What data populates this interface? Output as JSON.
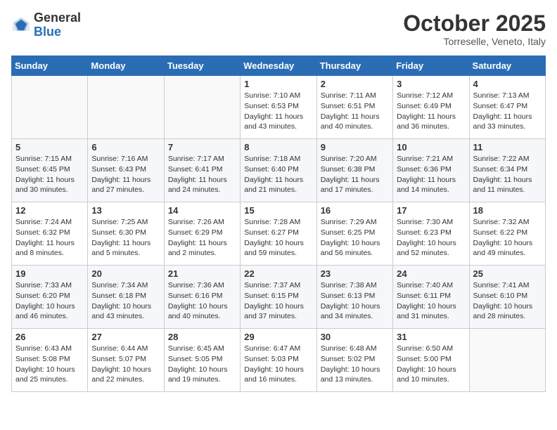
{
  "header": {
    "logo_general": "General",
    "logo_blue": "Blue",
    "month": "October 2025",
    "location": "Torreselle, Veneto, Italy"
  },
  "days_of_week": [
    "Sunday",
    "Monday",
    "Tuesday",
    "Wednesday",
    "Thursday",
    "Friday",
    "Saturday"
  ],
  "weeks": [
    [
      {
        "day": "",
        "info": ""
      },
      {
        "day": "",
        "info": ""
      },
      {
        "day": "",
        "info": ""
      },
      {
        "day": "1",
        "info": "Sunrise: 7:10 AM\nSunset: 6:53 PM\nDaylight: 11 hours and 43 minutes."
      },
      {
        "day": "2",
        "info": "Sunrise: 7:11 AM\nSunset: 6:51 PM\nDaylight: 11 hours and 40 minutes."
      },
      {
        "day": "3",
        "info": "Sunrise: 7:12 AM\nSunset: 6:49 PM\nDaylight: 11 hours and 36 minutes."
      },
      {
        "day": "4",
        "info": "Sunrise: 7:13 AM\nSunset: 6:47 PM\nDaylight: 11 hours and 33 minutes."
      }
    ],
    [
      {
        "day": "5",
        "info": "Sunrise: 7:15 AM\nSunset: 6:45 PM\nDaylight: 11 hours and 30 minutes."
      },
      {
        "day": "6",
        "info": "Sunrise: 7:16 AM\nSunset: 6:43 PM\nDaylight: 11 hours and 27 minutes."
      },
      {
        "day": "7",
        "info": "Sunrise: 7:17 AM\nSunset: 6:41 PM\nDaylight: 11 hours and 24 minutes."
      },
      {
        "day": "8",
        "info": "Sunrise: 7:18 AM\nSunset: 6:40 PM\nDaylight: 11 hours and 21 minutes."
      },
      {
        "day": "9",
        "info": "Sunrise: 7:20 AM\nSunset: 6:38 PM\nDaylight: 11 hours and 17 minutes."
      },
      {
        "day": "10",
        "info": "Sunrise: 7:21 AM\nSunset: 6:36 PM\nDaylight: 11 hours and 14 minutes."
      },
      {
        "day": "11",
        "info": "Sunrise: 7:22 AM\nSunset: 6:34 PM\nDaylight: 11 hours and 11 minutes."
      }
    ],
    [
      {
        "day": "12",
        "info": "Sunrise: 7:24 AM\nSunset: 6:32 PM\nDaylight: 11 hours and 8 minutes."
      },
      {
        "day": "13",
        "info": "Sunrise: 7:25 AM\nSunset: 6:30 PM\nDaylight: 11 hours and 5 minutes."
      },
      {
        "day": "14",
        "info": "Sunrise: 7:26 AM\nSunset: 6:29 PM\nDaylight: 11 hours and 2 minutes."
      },
      {
        "day": "15",
        "info": "Sunrise: 7:28 AM\nSunset: 6:27 PM\nDaylight: 10 hours and 59 minutes."
      },
      {
        "day": "16",
        "info": "Sunrise: 7:29 AM\nSunset: 6:25 PM\nDaylight: 10 hours and 56 minutes."
      },
      {
        "day": "17",
        "info": "Sunrise: 7:30 AM\nSunset: 6:23 PM\nDaylight: 10 hours and 52 minutes."
      },
      {
        "day": "18",
        "info": "Sunrise: 7:32 AM\nSunset: 6:22 PM\nDaylight: 10 hours and 49 minutes."
      }
    ],
    [
      {
        "day": "19",
        "info": "Sunrise: 7:33 AM\nSunset: 6:20 PM\nDaylight: 10 hours and 46 minutes."
      },
      {
        "day": "20",
        "info": "Sunrise: 7:34 AM\nSunset: 6:18 PM\nDaylight: 10 hours and 43 minutes."
      },
      {
        "day": "21",
        "info": "Sunrise: 7:36 AM\nSunset: 6:16 PM\nDaylight: 10 hours and 40 minutes."
      },
      {
        "day": "22",
        "info": "Sunrise: 7:37 AM\nSunset: 6:15 PM\nDaylight: 10 hours and 37 minutes."
      },
      {
        "day": "23",
        "info": "Sunrise: 7:38 AM\nSunset: 6:13 PM\nDaylight: 10 hours and 34 minutes."
      },
      {
        "day": "24",
        "info": "Sunrise: 7:40 AM\nSunset: 6:11 PM\nDaylight: 10 hours and 31 minutes."
      },
      {
        "day": "25",
        "info": "Sunrise: 7:41 AM\nSunset: 6:10 PM\nDaylight: 10 hours and 28 minutes."
      }
    ],
    [
      {
        "day": "26",
        "info": "Sunrise: 6:43 AM\nSunset: 5:08 PM\nDaylight: 10 hours and 25 minutes."
      },
      {
        "day": "27",
        "info": "Sunrise: 6:44 AM\nSunset: 5:07 PM\nDaylight: 10 hours and 22 minutes."
      },
      {
        "day": "28",
        "info": "Sunrise: 6:45 AM\nSunset: 5:05 PM\nDaylight: 10 hours and 19 minutes."
      },
      {
        "day": "29",
        "info": "Sunrise: 6:47 AM\nSunset: 5:03 PM\nDaylight: 10 hours and 16 minutes."
      },
      {
        "day": "30",
        "info": "Sunrise: 6:48 AM\nSunset: 5:02 PM\nDaylight: 10 hours and 13 minutes."
      },
      {
        "day": "31",
        "info": "Sunrise: 6:50 AM\nSunset: 5:00 PM\nDaylight: 10 hours and 10 minutes."
      },
      {
        "day": "",
        "info": ""
      }
    ]
  ]
}
